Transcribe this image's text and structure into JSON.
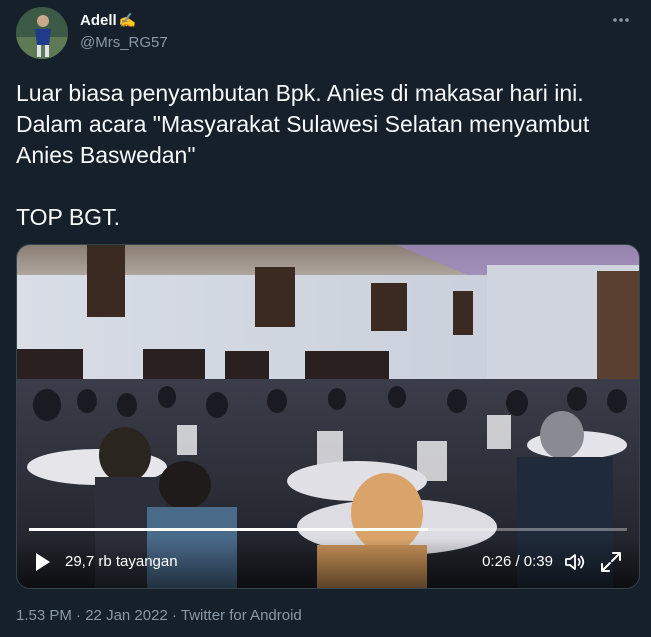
{
  "tweet": {
    "author_name": "Adell",
    "author_emoji": "✍️",
    "handle": "@Mrs_RG57",
    "text": "Luar biasa penyambutan Bpk. Anies di makasar hari ini. Dalam acara \"Masyarakat Sulawesi Selatan menyambut Anies Baswedan\"\n\nTOP BGT.",
    "time": "1.53 PM",
    "separator": "·",
    "date": "22 Jan 2022",
    "source": "Twitter for Android"
  },
  "video": {
    "views": "29,7 rb tayangan",
    "timecode": "0:26 / 0:39",
    "progress": 0.667,
    "icons": [
      "play-icon",
      "volume-icon",
      "fullscreen-icon"
    ]
  },
  "icons": {
    "more": "more-horizontal-icon"
  },
  "colors": {
    "background": "#15202b",
    "text": "#f7f9f9",
    "muted": "#8b98a5",
    "border": "#38444d"
  }
}
